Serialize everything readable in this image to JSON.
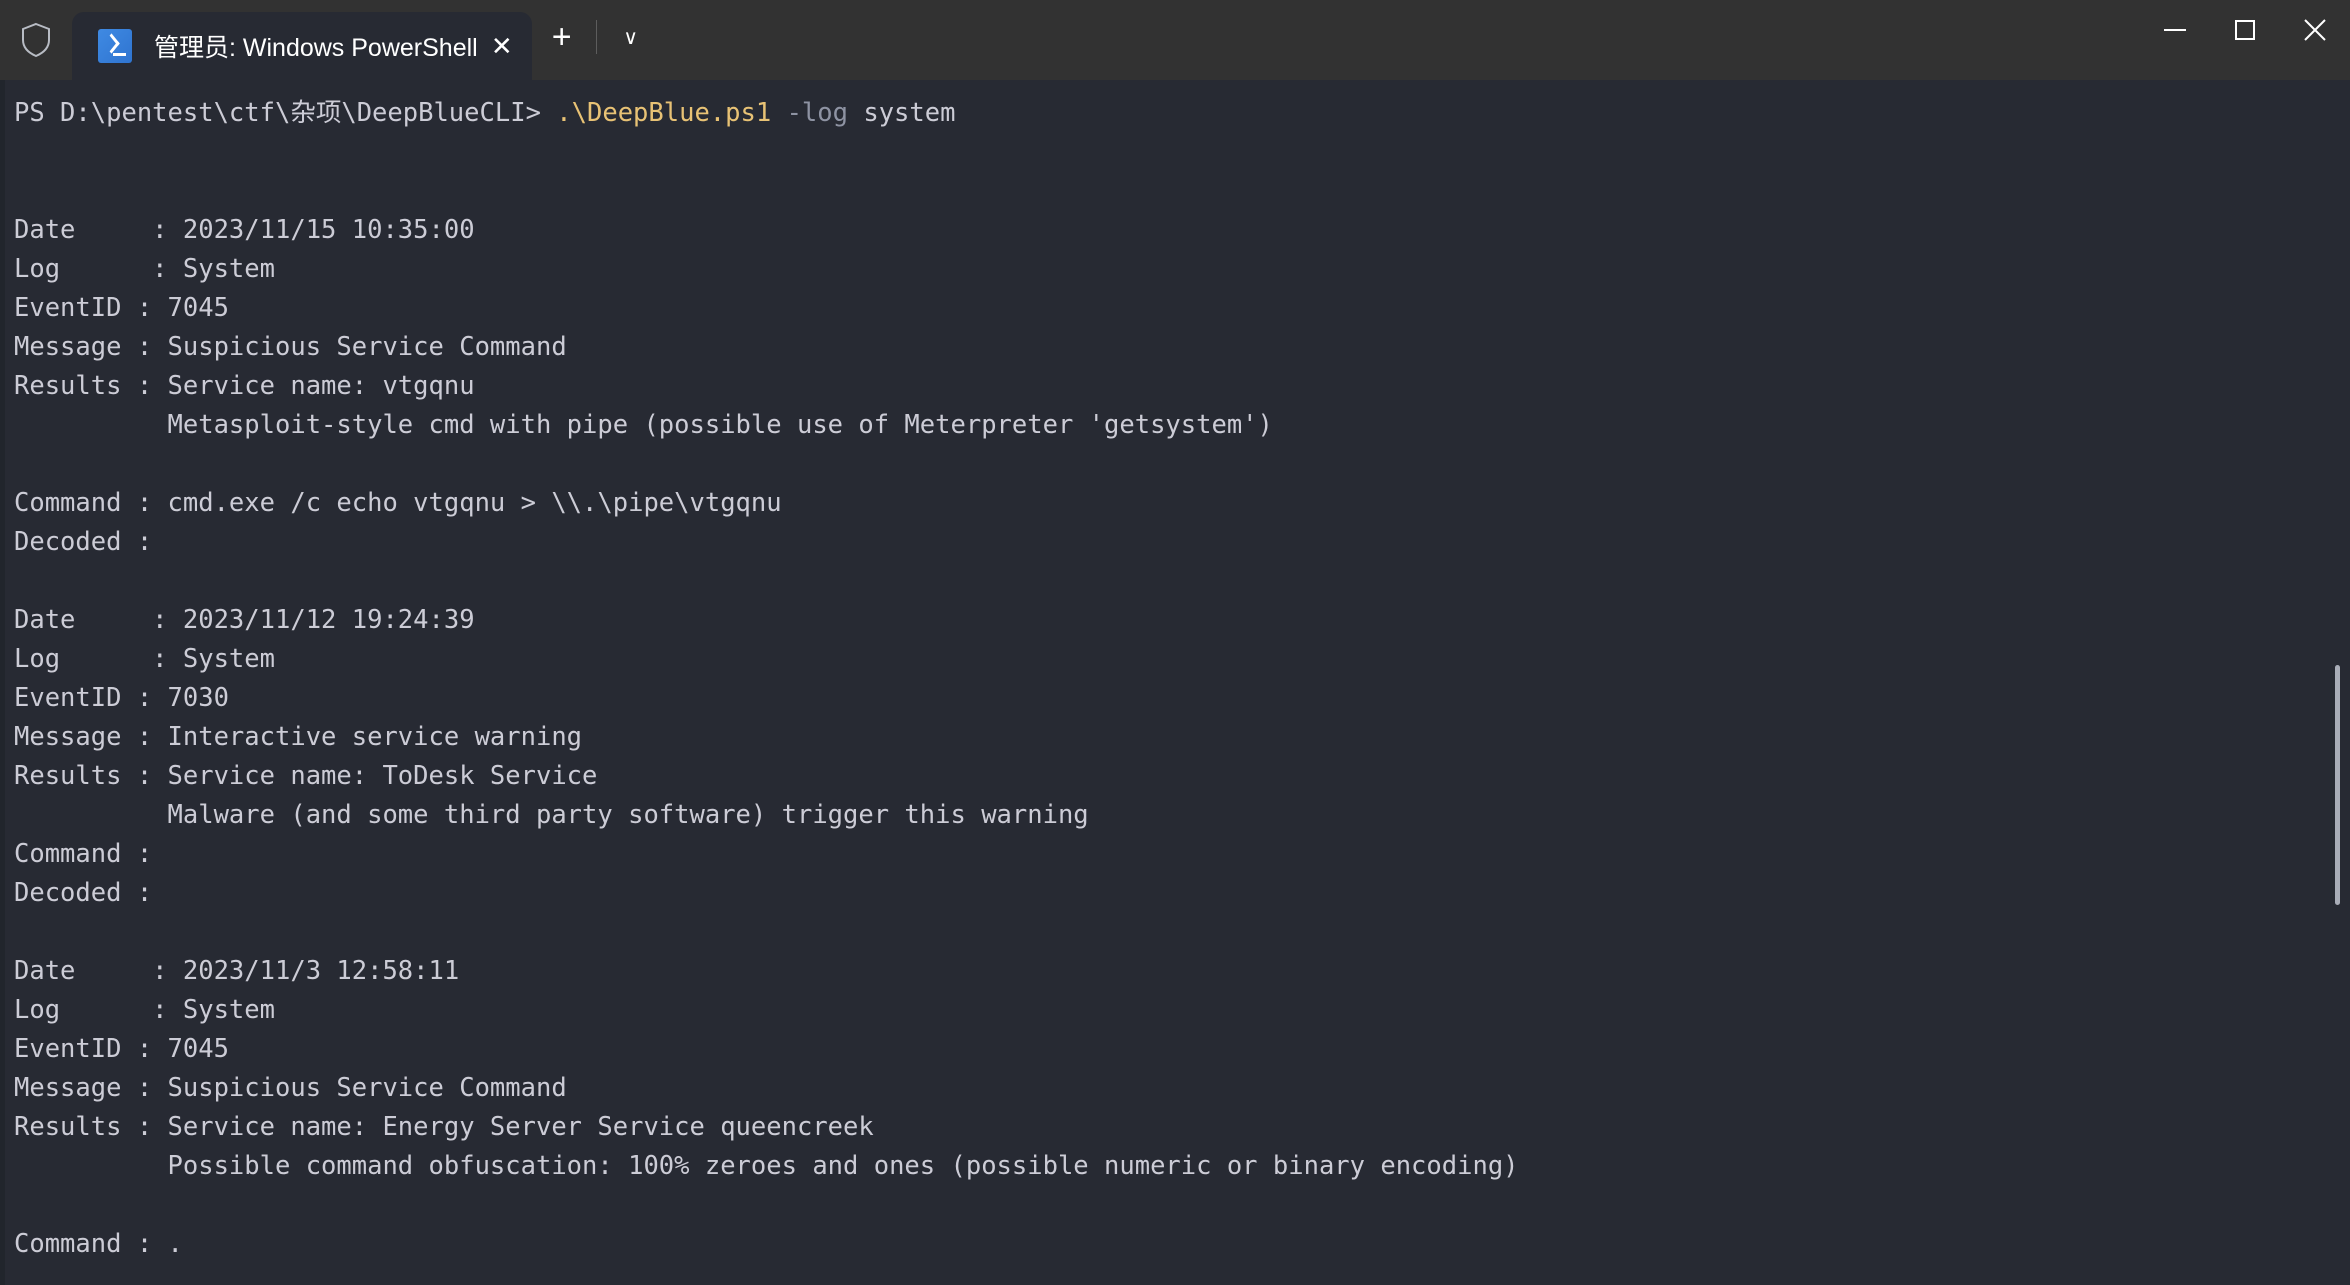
{
  "window": {
    "shield_icon": "shield-icon",
    "minimize_label": "—",
    "maximize_label": "□",
    "close_label": "✕"
  },
  "tabs": [
    {
      "icon": "powershell-icon",
      "title": "管理员: Windows PowerShell",
      "close_label": "✕"
    }
  ],
  "tabbar": {
    "new_tab_label": "+",
    "dropdown_label": "∨"
  },
  "terminal": {
    "prompt": "PS D:\\pentest\\ctf\\杂项\\DeepBlueCLI> ",
    "command_script": ".\\DeepBlue.ps1",
    "command_flag": " -log",
    "command_arg": " system",
    "colors": {
      "background": "#272a33",
      "foreground": "#ccccd6",
      "yellow": "#e8c275",
      "gray": "#8e93a3"
    },
    "records": [
      {
        "date_label": "Date     : ",
        "date_value": "2023/11/15 10:35:00",
        "log_label": "Log      : ",
        "log_value": "System",
        "eventid_label": "EventID : ",
        "eventid_value": "7045",
        "message_label": "Message : ",
        "message_value": "Suspicious Service Command",
        "results_label": "Results : ",
        "results_value": "Service name: vtgqnu",
        "results_extra": "          Metasploit-style cmd with pipe (possible use of Meterpreter 'getsystem')",
        "blank_after_results": true,
        "command_label": "Command : ",
        "command_value": "cmd.exe /c echo vtgqnu > \\\\.\\pipe\\vtgqnu",
        "decoded_label": "Decoded : ",
        "decoded_value": ""
      },
      {
        "date_label": "Date     : ",
        "date_value": "2023/11/12 19:24:39",
        "log_label": "Log      : ",
        "log_value": "System",
        "eventid_label": "EventID : ",
        "eventid_value": "7030",
        "message_label": "Message : ",
        "message_value": "Interactive service warning",
        "results_label": "Results : ",
        "results_value": "Service name: ToDesk Service",
        "results_extra": "          Malware (and some third party software) trigger this warning",
        "blank_after_results": false,
        "command_label": "Command : ",
        "command_value": "",
        "decoded_label": "Decoded : ",
        "decoded_value": ""
      },
      {
        "date_label": "Date     : ",
        "date_value": "2023/11/3 12:58:11",
        "log_label": "Log      : ",
        "log_value": "System",
        "eventid_label": "EventID : ",
        "eventid_value": "7045",
        "message_label": "Message : ",
        "message_value": "Suspicious Service Command",
        "results_label": "Results : ",
        "results_value": "Service name: Energy Server Service queencreek",
        "results_extra": "          Possible command obfuscation: 100% zeroes and ones (possible numeric or binary encoding)",
        "blank_after_results": true,
        "command_label": "Command : ",
        "command_value": ".",
        "decoded_label": "",
        "decoded_value": ""
      }
    ]
  }
}
